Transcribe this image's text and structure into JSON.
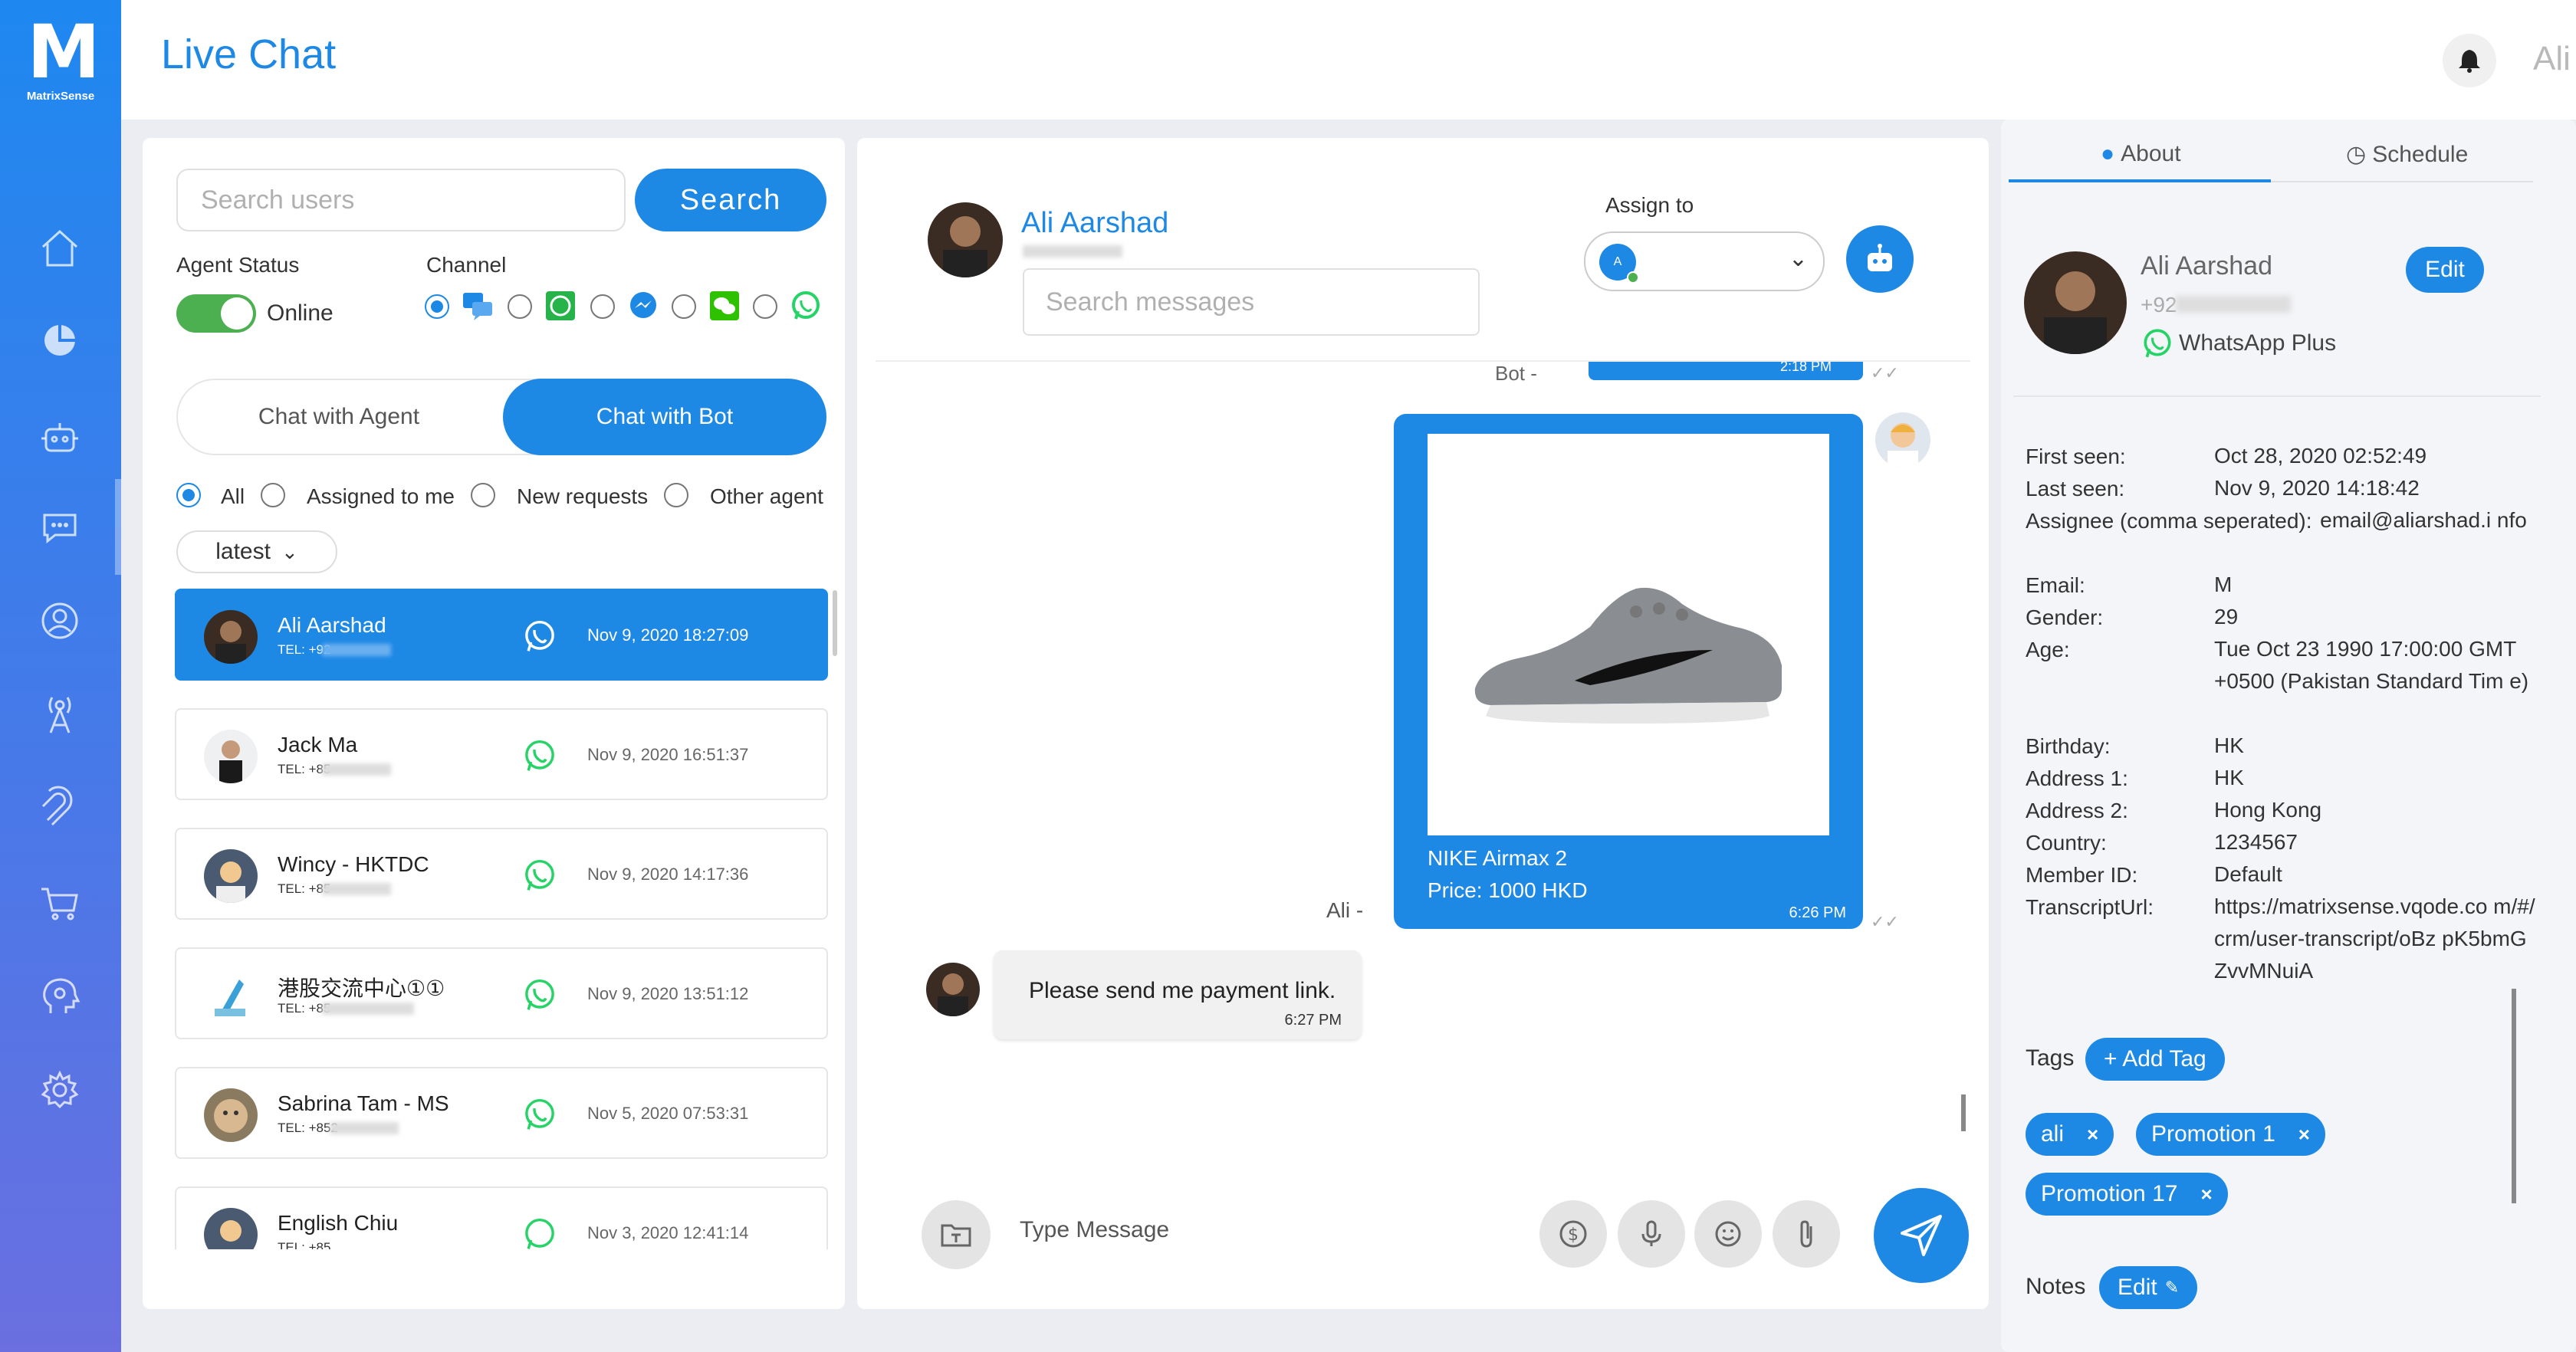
{
  "app": {
    "logo_text": "MatrixSense",
    "page_title": "Live Chat",
    "user_name": "Ali"
  },
  "left": {
    "search_placeholder": "Search users",
    "search_button": "Search",
    "agent_status_label": "Agent Status",
    "agent_status_value": "Online",
    "channel_label": "Channel",
    "tab_agent": "Chat with Agent",
    "tab_bot": "Chat with Bot",
    "filters": [
      "All",
      "Assigned to me",
      "New requests",
      "Other agent"
    ],
    "sort": "latest",
    "chats": [
      {
        "name": "Ali Aarshad",
        "tel": "TEL: +92",
        "date": "Nov 9, 2020 18:27:09"
      },
      {
        "name": "Jack Ma",
        "tel": "TEL: +85",
        "date": "Nov 9, 2020 16:51:37"
      },
      {
        "name": "Wincy - HKTDC",
        "tel": "TEL: +85",
        "date": "Nov 9, 2020 14:17:36"
      },
      {
        "name": "港股交流中心①①",
        "tel": "TEL: +85",
        "date": "Nov 9, 2020 13:51:12"
      },
      {
        "name": "Sabrina Tam - MS",
        "tel": "TEL: +852",
        "date": "Nov 5, 2020 07:53:31"
      },
      {
        "name": "English Chiu",
        "tel": "TEL: +85",
        "date": "Nov 3, 2020 12:41:14"
      }
    ]
  },
  "mid": {
    "contact_name": "Ali Aarshad",
    "search_messages_placeholder": "Search messages",
    "assign_label": "Assign to",
    "assign_avatar_letter": "A",
    "bot_label": "Bot -",
    "bot_time": "2:18 PM",
    "product_title": "NIKE Airmax 2",
    "product_price": "Price: 1000 HKD",
    "product_time": "6:26 PM",
    "ali_label": "Ali -",
    "customer_message": "Please send me payment link.",
    "customer_time": "6:27 PM",
    "type_placeholder": "Type Message"
  },
  "right": {
    "tab_about": "About",
    "tab_schedule": "Schedule",
    "name": "Ali Aarshad",
    "phone": "+92",
    "channel": "WhatsApp Plus",
    "edit": "Edit",
    "info": [
      {
        "label": "First seen:",
        "value": "Oct 28, 2020 02:52:49"
      },
      {
        "label": "Last seen:",
        "value": "Nov 9, 2020 14:18:42"
      },
      {
        "label": "Assignee (comma seperated):",
        "value": "email@aliarshad.i nfo"
      },
      {
        "label": "Email:",
        "value": "M"
      },
      {
        "label": "Gender:",
        "value": "29"
      },
      {
        "label": "Age:",
        "value": "Tue Oct 23 1990 17:00:00 GMT +0500 (Pakistan Standard Tim e)"
      },
      {
        "label": "Birthday:",
        "value": "HK"
      },
      {
        "label": "Address 1:",
        "value": "HK"
      },
      {
        "label": "Address 2:",
        "value": "Hong Kong"
      },
      {
        "label": "Country:",
        "value": "1234567"
      },
      {
        "label": "Member ID:",
        "value": "Default"
      },
      {
        "label": "TranscriptUrl:",
        "value": "https://matrixsense.vqode.co m/#/crm/user-transcript/oBz pK5bmGZvvMNuiA"
      }
    ],
    "tags_label": "Tags",
    "add_tag": "+ Add Tag",
    "tags": [
      "ali",
      "Promotion 1",
      "Promotion 17"
    ],
    "notes_label": "Notes",
    "notes_edit": "Edit"
  },
  "colors": {
    "accent": "#1e88e5",
    "online": "#4caf50",
    "whatsapp": "#25d366"
  }
}
